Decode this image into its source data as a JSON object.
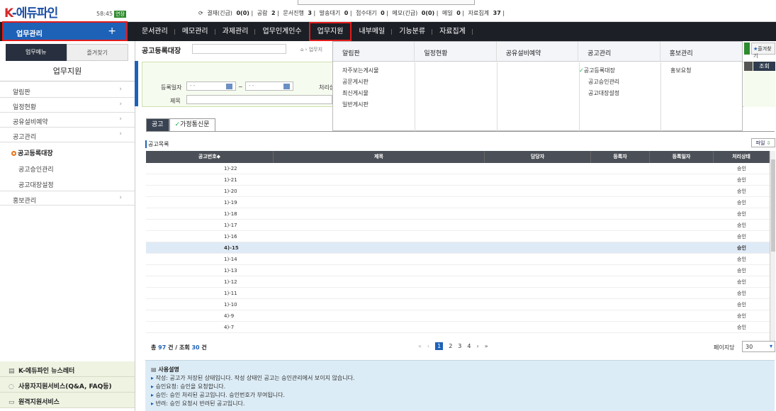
{
  "header": {
    "logo_k": "K",
    "logo_text": "-에듀파인",
    "timer": "58:45",
    "timer_badge": "연장",
    "links": [
      {
        "label": "결재(긴급)",
        "count": "0(0)"
      },
      {
        "label": "공람",
        "count": "2"
      },
      {
        "label": "문서진행",
        "count": "3"
      },
      {
        "label": "발송대기",
        "count": "0"
      },
      {
        "label": "접수대기",
        "count": "0"
      },
      {
        "label": "메모(긴급)",
        "count": "0(0)"
      },
      {
        "label": "메일",
        "count": "0"
      },
      {
        "label": "자료집계",
        "count": "37"
      }
    ]
  },
  "nav": {
    "biz_button": "업무관리",
    "biz_plus": "+",
    "menus": [
      "문서관리",
      "메모관리",
      "과제관리",
      "업무인계인수",
      "업무지원",
      "내부메일",
      "기능분류",
      "자료집계"
    ],
    "active_menu": "업무지원"
  },
  "sidebar": {
    "tabs": [
      "업무메뉴",
      "즐겨찾기"
    ],
    "title": "업무지원",
    "items": [
      "알림판",
      "일정현황",
      "공유설비예약",
      "공고관리"
    ],
    "subitems": [
      "공고등록대장",
      "공고승인관리",
      "공고대장설정"
    ],
    "after": [
      "홍보관리"
    ],
    "bottom": [
      "K-에듀파인 뉴스레터",
      "사용자지원서비스(Q&A, FAQ등)",
      "원격지원서비스"
    ]
  },
  "page": {
    "title": "공고등록대장",
    "breadcrumb": "업무지",
    "fav_button": "즐겨찾기",
    "search": {
      "reg_date_label": "등록일자",
      "date_placeholder": "- -",
      "tilde": "~",
      "process_label": "처리상",
      "title_label": "제목",
      "lookup_button": "조회"
    },
    "tabs": [
      "공고",
      "가정통신문"
    ],
    "list_label": "공고목록",
    "file_button": "파일"
  },
  "grid": {
    "columns": [
      "공고번호◆",
      "제목",
      "담당자",
      "등록자",
      "등록일자",
      "처리상태"
    ],
    "rows": [
      {
        "no": "1)-22",
        "status": "승인"
      },
      {
        "no": "1)-21",
        "status": "승인"
      },
      {
        "no": "1)-20",
        "status": "승인"
      },
      {
        "no": "1)-19",
        "status": "승인"
      },
      {
        "no": "1)-18",
        "status": "승인"
      },
      {
        "no": "1)-17",
        "status": "승인"
      },
      {
        "no": "1)-16",
        "status": "승인"
      },
      {
        "no": "4)-15",
        "status": "승인",
        "selected": true
      },
      {
        "no": "1)-14",
        "status": "승인"
      },
      {
        "no": "1)-13",
        "status": "승인"
      },
      {
        "no": "1)-12",
        "status": "승인"
      },
      {
        "no": "1)-11",
        "status": "승인"
      },
      {
        "no": "1)-10",
        "status": "승인"
      },
      {
        "no": "4)-9",
        "status": "승인"
      },
      {
        "no": "4)-7",
        "status": "승인"
      }
    ]
  },
  "footer": {
    "total_prefix": "총",
    "total": "97",
    "total_mid": "건 / 조회",
    "viewed": "30",
    "total_suffix": "건",
    "pages": [
      "1",
      "2",
      "3",
      "4"
    ],
    "current_page": "1",
    "per_page_label": "페이지당",
    "per_page": "30"
  },
  "usage": {
    "title": "사용설명",
    "lines": [
      "작성: 공고가 저장된 상태입니다. 작성 상태인 공고는 승인관리에서 보이지 않습니다.",
      "승인요청: 승인을 요청합니다.",
      "승인: 승인 처리된 공고입니다. 승인번호가 부여됩니다.",
      "반려: 승인 요청시 반려된 공고입니다."
    ]
  },
  "dropdown": {
    "headers": [
      "알림판",
      "일정현황",
      "공유설비예약",
      "공고관리",
      "홍보관리"
    ],
    "col0": [
      "자주보는게시물",
      "공문게시판",
      "최신게시물",
      "일반게시판"
    ],
    "col3": [
      "공고등록대장",
      "공고승인관리",
      "공고대장설정"
    ],
    "col4": [
      "홍보요청"
    ]
  }
}
